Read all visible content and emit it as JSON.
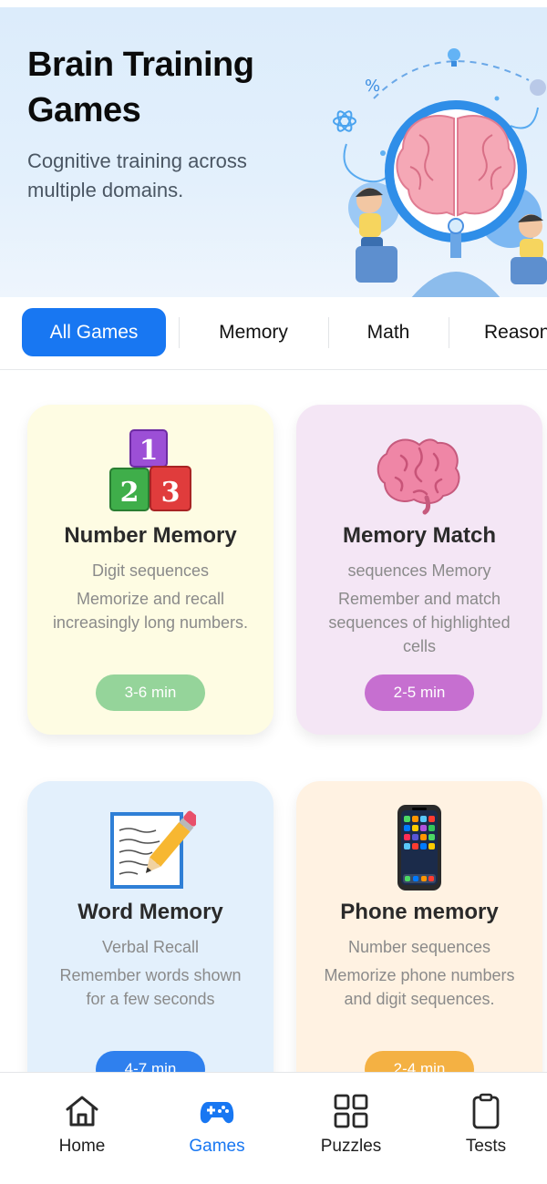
{
  "hero": {
    "title": "Brain Training Games",
    "subtitle": "Cognitive training across multiple domains.",
    "illustration": "brain-training-illustration"
  },
  "tabs": [
    {
      "label": "All Games",
      "active": true
    },
    {
      "label": "Memory",
      "active": false
    },
    {
      "label": "Math",
      "active": false
    },
    {
      "label": "Reason",
      "active": false
    }
  ],
  "games": [
    {
      "title": "Number Memory",
      "subtitle": "Digit sequences",
      "description": "Memorize and recall increasingly long numbers.",
      "duration": "3-6 min",
      "icon": "number-blocks-icon",
      "bg": "#fefce3",
      "pill": "#95d49a"
    },
    {
      "title": "Memory Match",
      "subtitle": "sequences Memory",
      "description": "Remember and match sequences of highlighted cells",
      "duration": "2-5 min",
      "icon": "brain-icon",
      "bg": "#f4e6f5",
      "pill": "#c66fd0"
    },
    {
      "title": "Word Memory",
      "subtitle": "Verbal Recall",
      "description": "Remember words shown for a few seconds",
      "duration": "4-7 min",
      "icon": "notepad-pencil-icon",
      "bg": "#e3f0fc",
      "pill": "#2f80ee"
    },
    {
      "title": "Phone memory",
      "subtitle": "Number sequences",
      "description": "Memorize phone numbers and digit sequences.",
      "duration": "2-4 min",
      "icon": "smartphone-icon",
      "bg": "#fff2e2",
      "pill": "#f4b143"
    }
  ],
  "nav": [
    {
      "label": "Home",
      "icon": "home-icon",
      "active": false
    },
    {
      "label": "Games",
      "icon": "gamepad-icon",
      "active": true
    },
    {
      "label": "Puzzles",
      "icon": "grid-icon",
      "active": false
    },
    {
      "label": "Tests",
      "icon": "clipboard-icon",
      "active": false
    }
  ],
  "colors": {
    "accent": "#1877f2",
    "hero_bg": "#dcecfb"
  }
}
